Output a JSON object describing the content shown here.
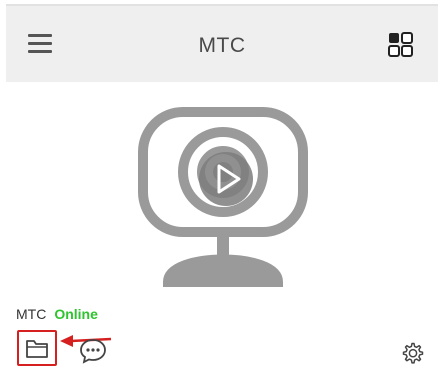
{
  "header": {
    "title": "MTC",
    "menu_icon": "hamburger-menu-icon",
    "grid_icon": "grid-view-icon"
  },
  "video": {
    "placeholder_icon": "webcam-icon",
    "play_icon": "play-icon"
  },
  "device": {
    "name": "MTC",
    "status": "Online",
    "status_color": "#2fc42f"
  },
  "toolbar": {
    "files_icon": "folder-icon",
    "chat_icon": "chat-bubble-icon",
    "settings_icon": "gear-icon",
    "highlight_color": "#d62020"
  }
}
